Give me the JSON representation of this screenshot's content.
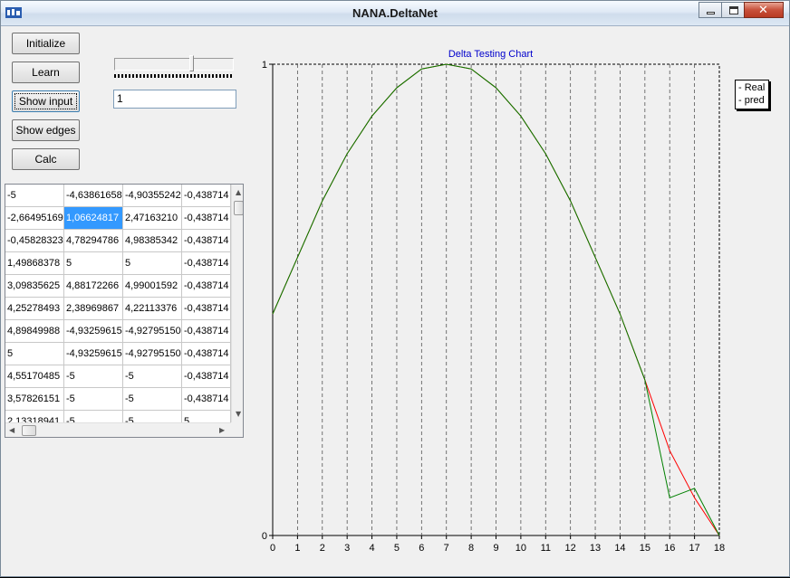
{
  "window": {
    "title": "NANA.DeltaNet",
    "icon": "app-icon",
    "controls": [
      "minimize-icon",
      "maximize-icon",
      "close-icon"
    ]
  },
  "buttons": {
    "initialize": "Initialize",
    "learn": "Learn",
    "show_input": "Show input",
    "show_edges": "Show edges",
    "calc": "Calc"
  },
  "slider": {
    "level": 0.65
  },
  "input_value": "1",
  "grid": {
    "rows": [
      [
        "-5",
        "-4,63861658",
        "-4,90355242",
        "-0,438714"
      ],
      [
        "-2,66495169",
        "1,06624817",
        "2,47163210",
        "-0,438714"
      ],
      [
        "-0,45828323",
        "4,78294786",
        "4,98385342",
        "-0,438714"
      ],
      [
        "1,49868378",
        "5",
        "5",
        "-0,438714"
      ],
      [
        "3,09835625",
        "4,88172266",
        "4,99001592",
        "-0,438714"
      ],
      [
        "4,25278493",
        "2,38969867",
        "4,22113376",
        "-0,438714"
      ],
      [
        "4,89849988",
        "-4,93259615",
        "-4,92795150",
        "-0,438714"
      ],
      [
        "5",
        "-4,93259615",
        "-4,92795150",
        "-0,438714"
      ],
      [
        "4,55170485",
        "-5",
        "-5",
        "-0,438714"
      ],
      [
        "3,57826151",
        "-5",
        "-5",
        "-0,438714"
      ],
      [
        "2,13318941",
        "-5",
        "-5",
        "5"
      ]
    ],
    "selected": [
      1,
      1
    ]
  },
  "chart_data": {
    "type": "line",
    "title": "Delta Testing Chart",
    "xlim": [
      0,
      18
    ],
    "ylim": [
      0,
      1
    ],
    "x_ticks": [
      "0",
      "1",
      "2",
      "3",
      "4",
      "5",
      "6",
      "7",
      "8",
      "9",
      "10",
      "11",
      "12",
      "13",
      "14",
      "15",
      "16",
      "17",
      "18"
    ],
    "y_ticks": [
      "0",
      "1"
    ],
    "grid": "vertical dashed",
    "legend_position": "outside-right-top",
    "x": [
      0,
      1,
      2,
      3,
      4,
      5,
      6,
      7,
      8,
      9,
      10,
      11,
      12,
      13,
      14,
      15,
      16,
      17,
      18
    ],
    "series": [
      {
        "name": "Real",
        "color": "#ff0000",
        "values": [
          0.47,
          0.59,
          0.71,
          0.81,
          0.89,
          0.95,
          0.99,
          1.0,
          0.99,
          0.95,
          0.89,
          0.81,
          0.71,
          0.59,
          0.47,
          0.33,
          0.18,
          0.08,
          0.0
        ]
      },
      {
        "name": "pred",
        "color": "#008000",
        "values": [
          0.47,
          0.59,
          0.71,
          0.81,
          0.89,
          0.95,
          0.99,
          1.0,
          0.99,
          0.95,
          0.89,
          0.81,
          0.71,
          0.59,
          0.47,
          0.33,
          0.08,
          0.1,
          0.0
        ]
      }
    ]
  }
}
